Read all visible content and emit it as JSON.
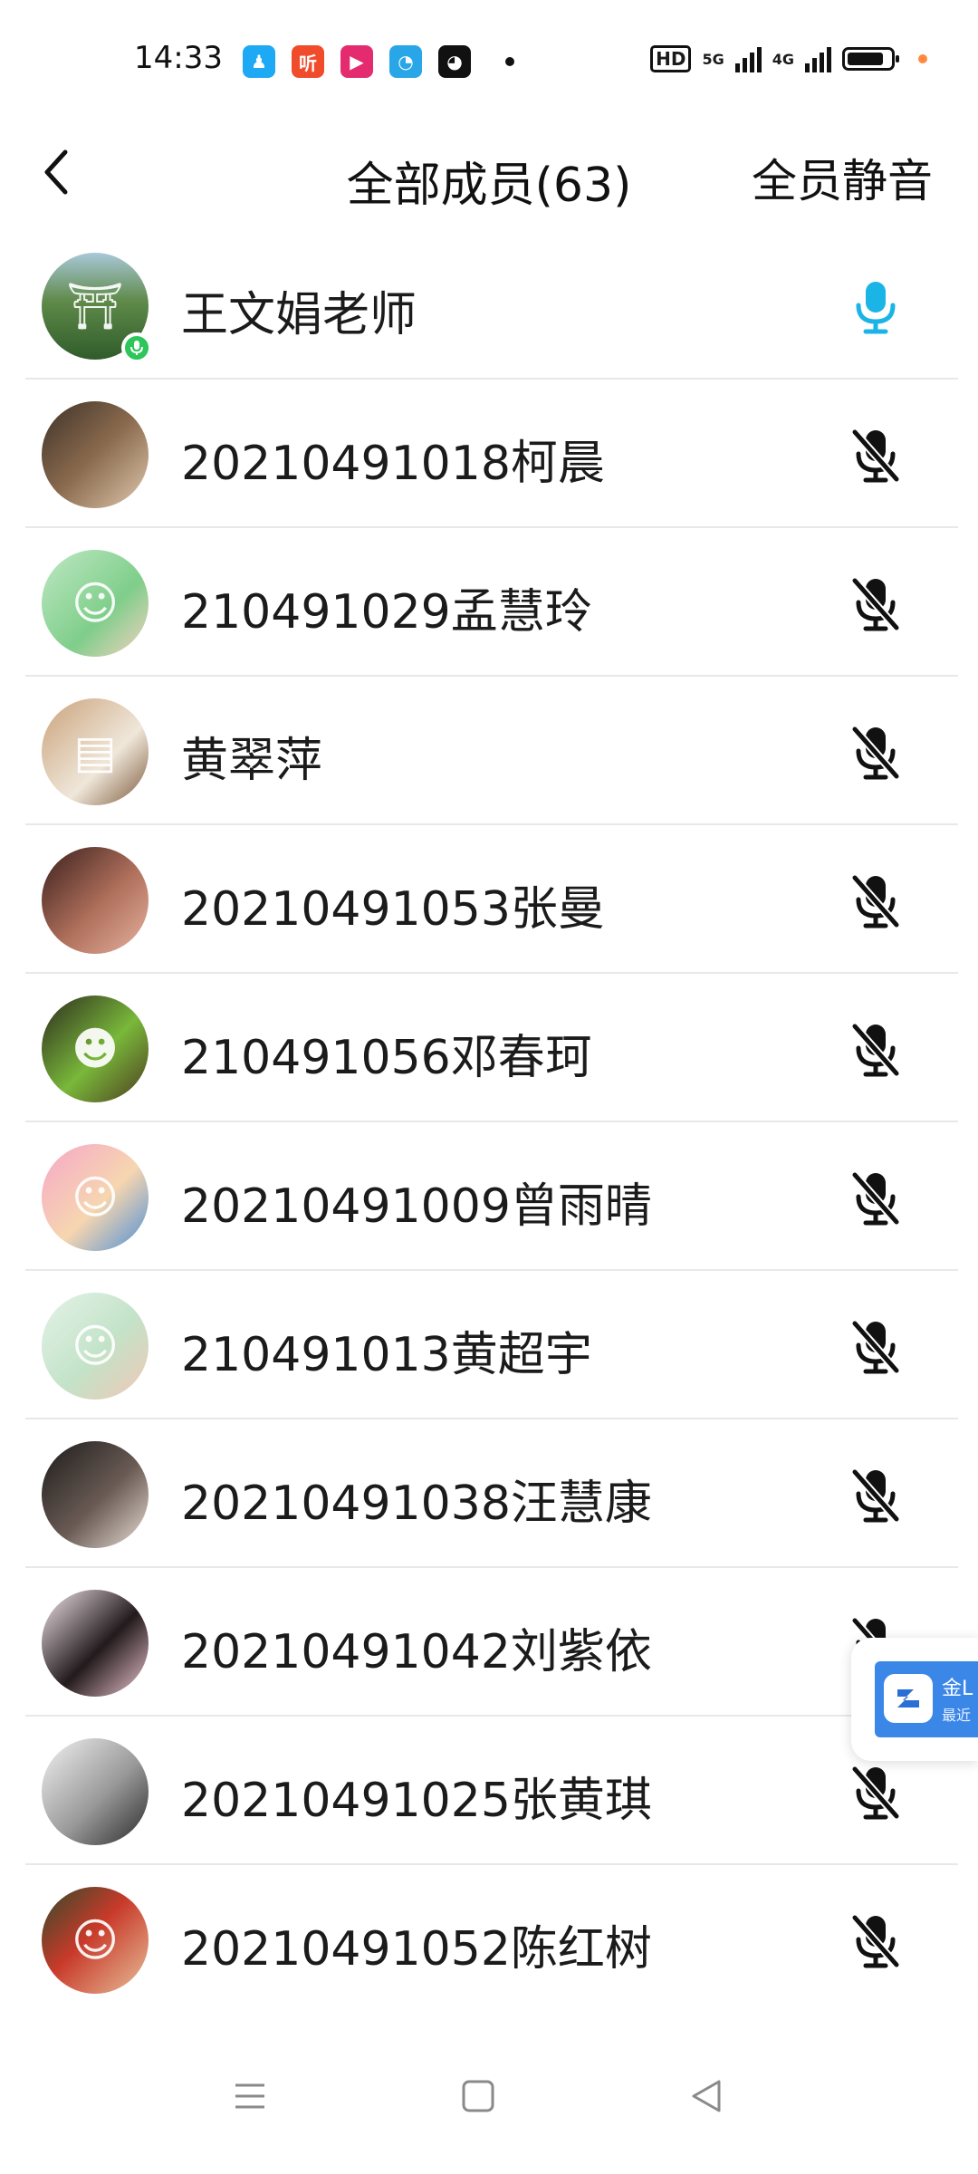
{
  "status_bar": {
    "time": "14:33",
    "app_icons": [
      {
        "icon": "qq-icon",
        "color": "#1ea9f5",
        "glyph": "♟"
      },
      {
        "icon": "ting-icon",
        "color": "#f04c2c",
        "glyph": "听"
      },
      {
        "icon": "video-app-icon",
        "color": "#e52b6f",
        "glyph": "▶"
      },
      {
        "icon": "browser-icon",
        "color": "#28a6e8",
        "glyph": "◔"
      },
      {
        "icon": "panda-icon",
        "color": "#111111",
        "glyph": "◕"
      }
    ],
    "hd_badge": "HD",
    "net_5g": "5G",
    "net_4g": "4G",
    "battery_level": 0.85
  },
  "header": {
    "title": "全部成员(63)",
    "mute_all": "全员静音"
  },
  "members": [
    {
      "name": "王文娟老师",
      "avatar_bg": "linear-gradient(180deg,#a9c8d8 0%,#5f8a4a 45%,#2f5c2a 100%)",
      "avatar_glyph": "⛩",
      "mic": "on",
      "speaking": true
    },
    {
      "name": "20210491018柯晨",
      "avatar_bg": "linear-gradient(135deg,#3d3228 0%,#8a6a4e 50%,#e0c9ae 100%)",
      "avatar_glyph": "",
      "mic": "off",
      "speaking": false
    },
    {
      "name": "210491029孟慧玲",
      "avatar_bg": "linear-gradient(135deg,#bfe8c4 0%,#7fce8a 60%,#f6d2c2 100%)",
      "avatar_glyph": "☺",
      "mic": "off",
      "speaking": false
    },
    {
      "name": "黄翠萍",
      "avatar_bg": "linear-gradient(135deg,#caa27a 0%,#efe7da 60%,#7a5638 100%)",
      "avatar_glyph": "▤",
      "mic": "off",
      "speaking": false
    },
    {
      "name": "20210491053张曼",
      "avatar_bg": "linear-gradient(135deg,#3a1f1c 0%,#b0705c 55%,#e6b3a0 100%)",
      "avatar_glyph": "",
      "mic": "off",
      "speaking": false
    },
    {
      "name": "210491056邓春珂",
      "avatar_bg": "linear-gradient(135deg,#2c2a1e 0%,#79b83a 55%,#4d3a20 100%)",
      "avatar_glyph": "☻",
      "mic": "off",
      "speaking": false
    },
    {
      "name": "20210491009曾雨晴",
      "avatar_bg": "linear-gradient(135deg,#f6a7c8 0%,#f6d6b0 55%,#4c8fd6 100%)",
      "avatar_glyph": "☺",
      "mic": "off",
      "speaking": false
    },
    {
      "name": "210491013黄超宇",
      "avatar_bg": "linear-gradient(135deg,#e5f2e8 0%,#c3e3c8 55%,#f1c7b6 100%)",
      "avatar_glyph": "☺",
      "mic": "off",
      "speaking": false
    },
    {
      "name": "20210491038汪慧康",
      "avatar_bg": "linear-gradient(135deg,#1b1b1b 0%,#6a5b54 55%,#e9dfd8 100%)",
      "avatar_glyph": "",
      "mic": "off",
      "speaking": false
    },
    {
      "name": "20210491042刘紫依",
      "avatar_bg": "linear-gradient(135deg,#f4e7ec 0%,#221a1c 55%,#f0c7d2 100%)",
      "avatar_glyph": "",
      "mic": "off",
      "speaking": false
    },
    {
      "name": "20210491025张黄琪",
      "avatar_bg": "linear-gradient(135deg,#f2f2f2 0%,#9a9a9a 55%,#2a2a2a 100%)",
      "avatar_glyph": "",
      "mic": "off",
      "speaking": false
    },
    {
      "name": "20210491052陈红树",
      "avatar_bg": "linear-gradient(135deg,#2f4a2a 0%,#c83a2a 45%,#e7c09a 100%)",
      "avatar_glyph": "☺",
      "mic": "off",
      "speaking": false
    }
  ],
  "float_widget": {
    "text1": "金L",
    "text2": "最近"
  }
}
